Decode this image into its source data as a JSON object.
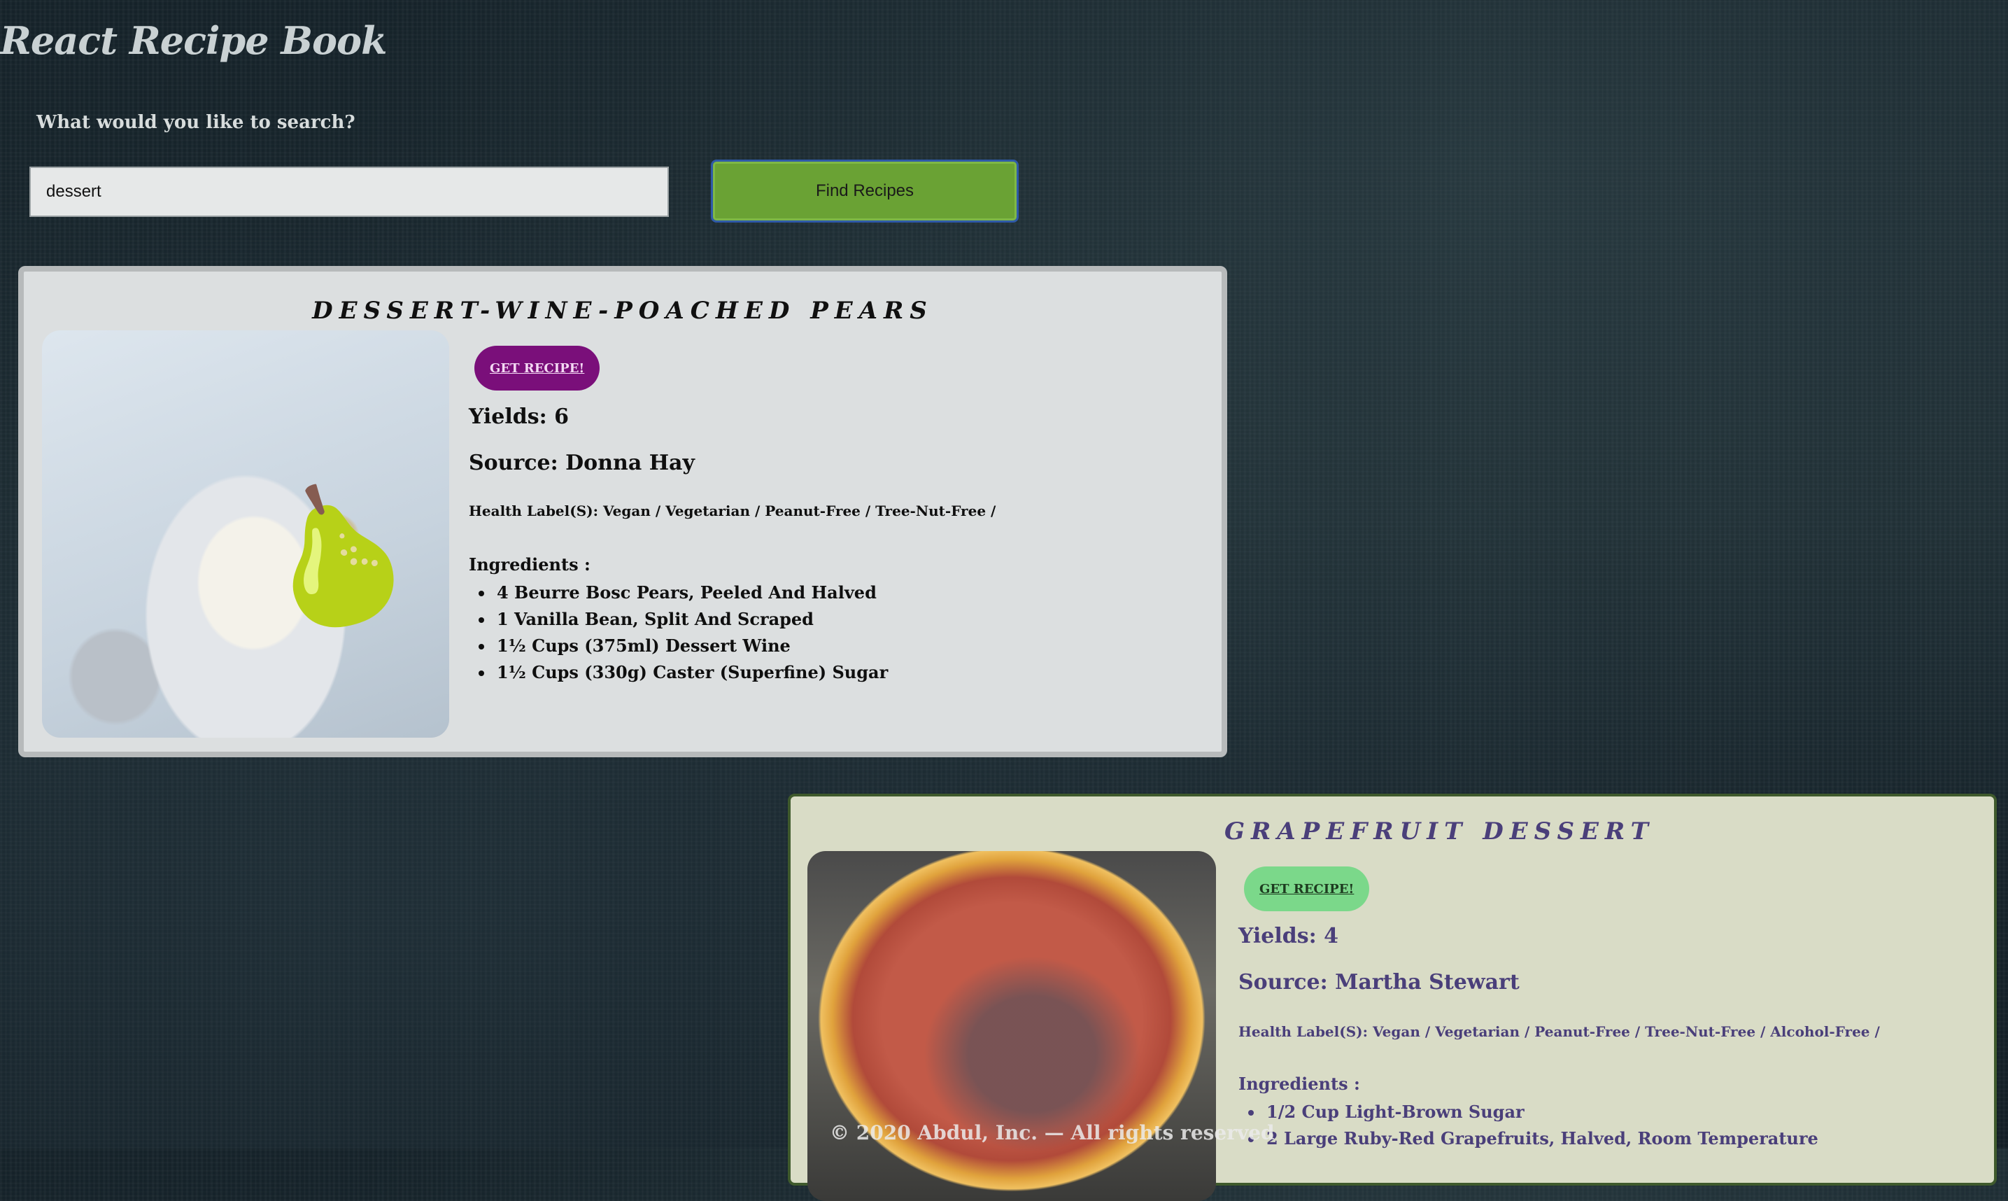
{
  "app": {
    "title": "React Recipe Book"
  },
  "search": {
    "prompt": "What would you like to search?",
    "value": "dessert",
    "button_label": "Find Recipes"
  },
  "recipes": [
    {
      "title": "DESSERT-WINE-POACHED PEARS",
      "button_label": "GET RECIPE!",
      "yields": "Yields: 6",
      "source": "Source: Donna Hay",
      "health_labels": "Health Label(S): Vegan / Vegetarian / Peanut-Free / Tree-Nut-Free /",
      "ingredients_heading": "Ingredients :",
      "ingredients": [
        "4 Beurre Bosc Pears, Peeled And Halved",
        "1 Vanilla Bean, Split And Scraped",
        "1½ Cups (375ml) Dessert Wine",
        "1½ Cups (330g) Caster (Superfine) Sugar"
      ],
      "colors": {
        "card": "#dcdfe0",
        "button": "#7a0f7a",
        "text": "#0f0f0f"
      }
    },
    {
      "title": "GRAPEFRUIT DESSERT",
      "button_label": "GET RECIPE!",
      "yields": "Yields: 4",
      "source": "Source: Martha Stewart",
      "health_labels": "Health Label(S): Vegan / Vegetarian / Peanut-Free / Tree-Nut-Free / Alcohol-Free /",
      "ingredients_heading": "Ingredients :",
      "ingredients": [
        "1/2 Cup Light-Brown Sugar",
        "2 Large Ruby-Red Grapefruits, Halved, Room Temperature"
      ],
      "colors": {
        "card": "#d9dcc6",
        "button": "#7bd88a",
        "text": "#4a3f7a"
      }
    }
  ],
  "footer": {
    "text": "© 2020 Abdul, Inc. — All rights reserved"
  }
}
